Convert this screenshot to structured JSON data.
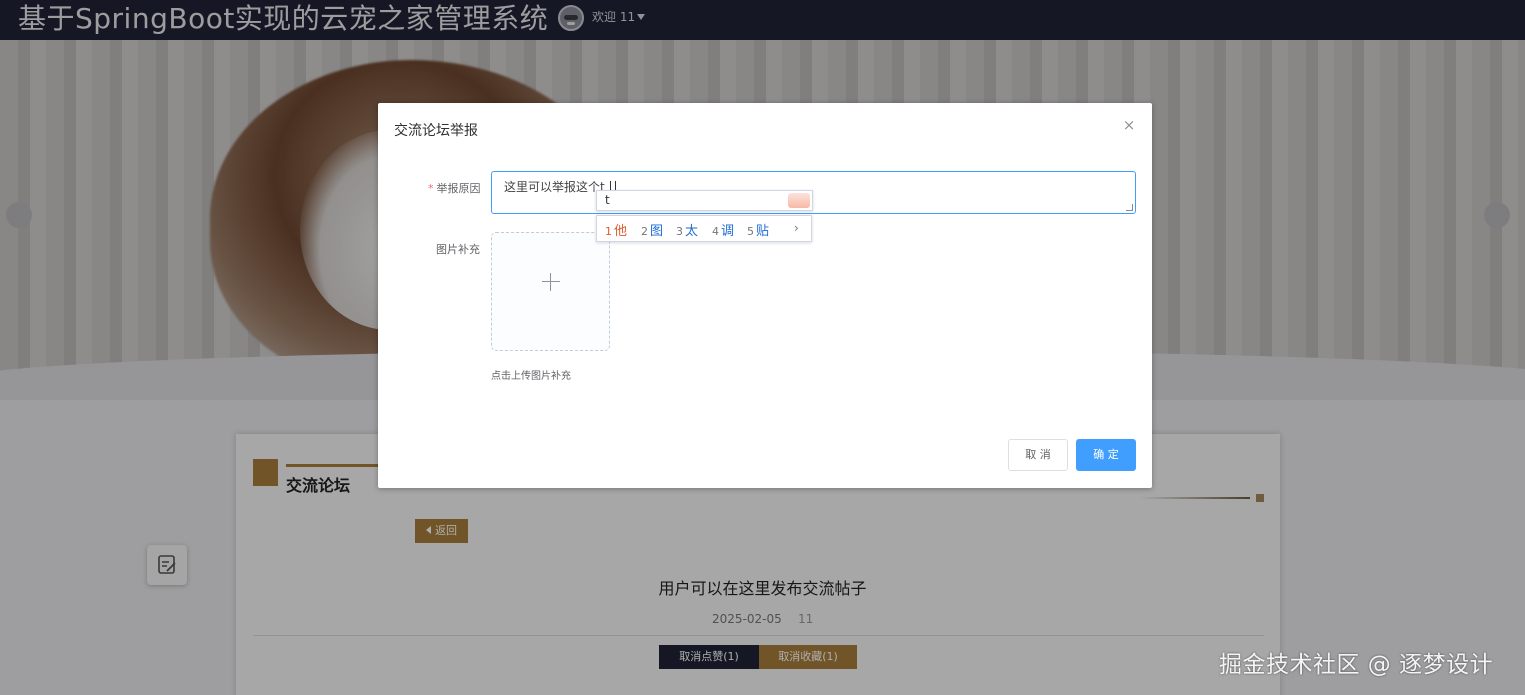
{
  "header": {
    "site_title": "基于SpringBoot实现的云宠之家管理系统",
    "welcome_text": "欢迎 11",
    "avatar_icon": "robot-avatar-icon"
  },
  "forum": {
    "section_title": "交流论坛",
    "back_label": "返回",
    "post_title": "用户可以在这里发布交流帖子",
    "post_date": "2025-02-05",
    "post_author": "11",
    "like_label": "取消点赞(1)",
    "favorite_label": "取消收藏(1)"
  },
  "dialog": {
    "title": "交流论坛举报",
    "reason_label": "举报原因",
    "reason_value": "这里可以举报这个t",
    "image_label": "图片补充",
    "upload_tip": "点击上传图片补充",
    "cancel_label": "取 消",
    "confirm_label": "确 定"
  },
  "ime": {
    "composition": "t",
    "candidates": [
      {
        "num": "1",
        "text": "他"
      },
      {
        "num": "2",
        "text": "图"
      },
      {
        "num": "3",
        "text": "太"
      },
      {
        "num": "4",
        "text": "调"
      },
      {
        "num": "5",
        "text": "贴"
      }
    ]
  },
  "watermark": "掘金技术社区 @ 逐梦设计",
  "colors": {
    "header_bg": "#1f2436",
    "accent_gold": "#a77e3b",
    "primary_blue": "#409eff",
    "required_red": "#f56c6c"
  }
}
